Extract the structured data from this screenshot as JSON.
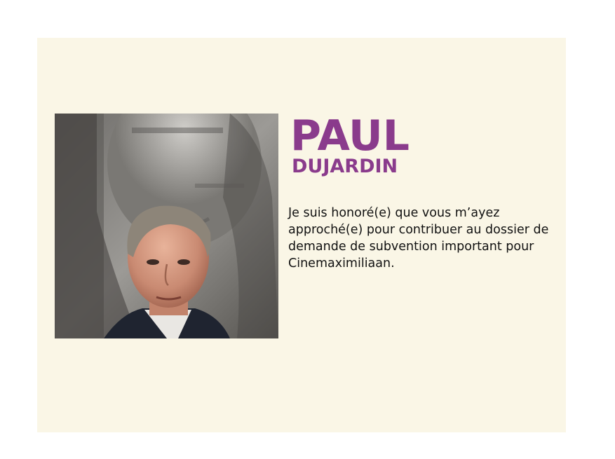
{
  "profile": {
    "first_name": "PAUL",
    "last_name": "DUJARDIN",
    "quote": "Je suis honoré(e) que vous m’ayez approché(e) pour contribuer au dossier de demande de subvention important pour Cinemaximiliaan."
  },
  "colors": {
    "background": "#ffffff",
    "card": "#faf6e6",
    "accent": "#8a3b8c",
    "text": "#111111"
  }
}
